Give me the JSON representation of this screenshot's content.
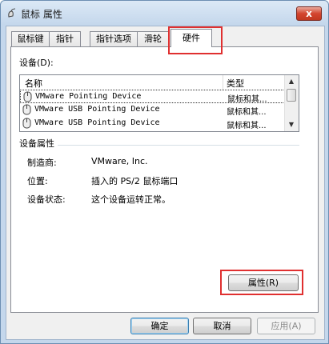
{
  "window": {
    "title": "鼠标 属性",
    "close_glyph": "x"
  },
  "tabs": [
    {
      "label": "鼠标键"
    },
    {
      "label": "指针"
    },
    {
      "label": "指针选项"
    },
    {
      "label": "滑轮"
    },
    {
      "label": "硬件",
      "active": true
    }
  ],
  "devices": {
    "label": "设备(D):",
    "columns": {
      "name": "名称",
      "type": "类型"
    },
    "rows": [
      {
        "name": "VMware Pointing Device",
        "type": "鼠标和其..."
      },
      {
        "name": "VMware USB Pointing Device",
        "type": "鼠标和其..."
      },
      {
        "name": "VMware USB Pointing Device",
        "type": "鼠标和其..."
      }
    ]
  },
  "properties": {
    "group_title": "设备属性",
    "manufacturer_label": "制造商:",
    "manufacturer_value": "VMware, Inc.",
    "location_label": "位置:",
    "location_value": "插入的 PS/2 鼠标端口",
    "status_label": "设备状态:",
    "status_value": "这个设备运转正常。",
    "button_label": "属性(R)"
  },
  "footer": {
    "ok": "确定",
    "cancel": "取消",
    "apply": "应用(A)"
  },
  "colors": {
    "highlight": "#e03030",
    "title_gradient_top": "#dce9f6"
  }
}
